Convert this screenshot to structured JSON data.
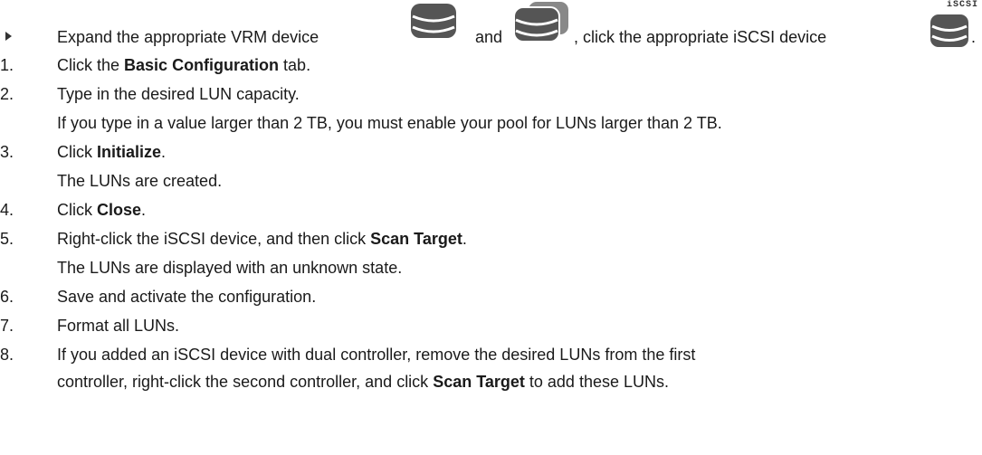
{
  "intro": {
    "part1": "Expand the appropriate VRM device",
    "part2": "and",
    "part3": ", click the appropriate iSCSI device",
    "part4": ".",
    "iscsi_label": "iSCSI",
    "icons": [
      "vrm-device-icon",
      "vrm-device-group-icon",
      "iscsi-device-icon"
    ]
  },
  "steps": [
    {
      "num": "1.",
      "pre": "Click the ",
      "bold": "Basic Configuration",
      "post": " tab."
    },
    {
      "num": "2.",
      "text": "Type in the desired LUN capacity.",
      "note": "If you type in a value larger than 2 TB, you must enable your pool for LUNs larger than 2 TB."
    },
    {
      "num": "3.",
      "pre": "Click ",
      "bold": "Initialize",
      "post": ".",
      "note": "The LUNs are created."
    },
    {
      "num": "4.",
      "pre": "Click ",
      "bold": "Close",
      "post": "."
    },
    {
      "num": "5.",
      "pre": "Right-click the iSCSI device, and then click ",
      "bold": "Scan Target",
      "post": ".",
      "note": "The LUNs are displayed with an unknown state."
    },
    {
      "num": "6.",
      "text": "Save and activate the configuration."
    },
    {
      "num": "7.",
      "text": "Format all LUNs."
    },
    {
      "num": "8.",
      "text": "If you added an iSCSI device with dual controller, remove the desired LUNs from the first",
      "cont_pre": "controller, right-click the second controller, and click ",
      "cont_bold": "Scan Target",
      "cont_post": " to add these LUNs."
    }
  ]
}
